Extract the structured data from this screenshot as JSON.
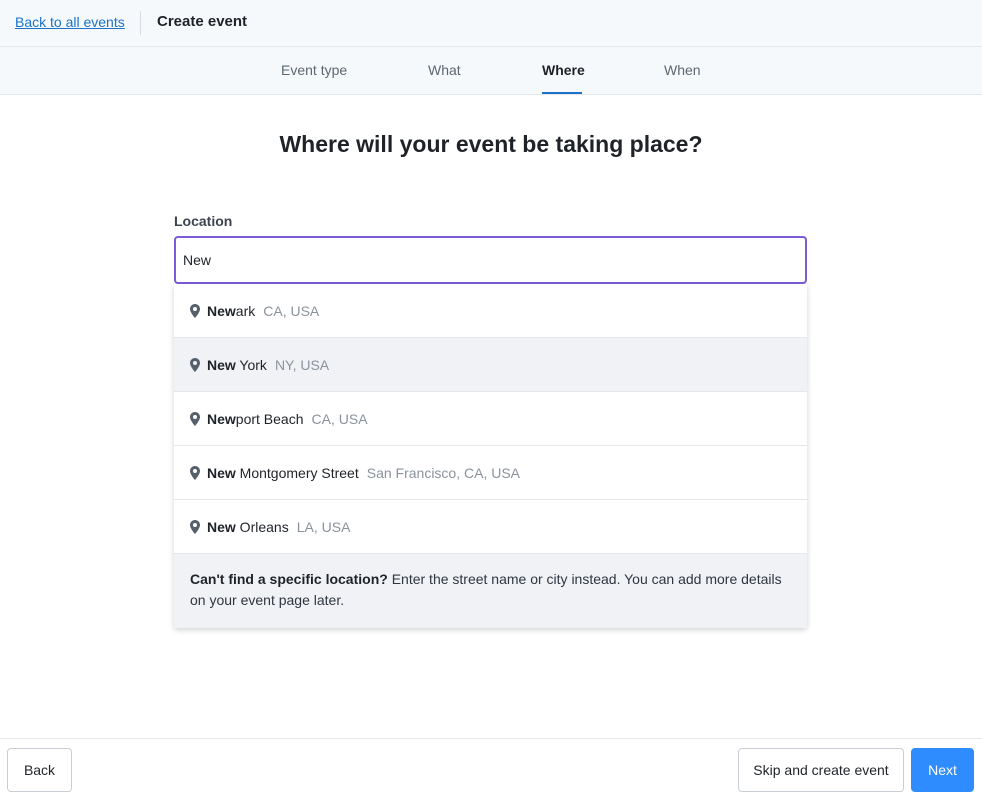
{
  "header": {
    "back_link": "Back to all events",
    "title": "Create event"
  },
  "steps": [
    {
      "label": "Event type",
      "active": false
    },
    {
      "label": "What",
      "active": false
    },
    {
      "label": "Where",
      "active": true
    },
    {
      "label": "When",
      "active": false
    }
  ],
  "main": {
    "heading": "Where will your event be taking place?",
    "location_label": "Location",
    "location_value": "New"
  },
  "suggestions": [
    {
      "match": "New",
      "rest": "ark",
      "region": "CA, USA",
      "icon": "map-pin-icon"
    },
    {
      "match": "New",
      "rest": " York",
      "region": "NY, USA",
      "icon": "map-pin-icon",
      "highlighted": true
    },
    {
      "match": "New",
      "rest": "port Beach",
      "region": "CA, USA",
      "icon": "map-pin-icon"
    },
    {
      "match": "New",
      "rest": " Montgomery Street",
      "region": "San Francisco, CA, USA",
      "icon": "map-pin-icon"
    },
    {
      "match": "New",
      "rest": " Orleans",
      "region": "LA, USA",
      "icon": "map-pin-icon"
    }
  ],
  "hint": {
    "bold": "Can't find a specific location?",
    "text": " Enter the street name or city instead. You can add more details on your event page later."
  },
  "footer": {
    "back_label": "Back",
    "skip_label": "Skip and create event",
    "next_label": "Next"
  },
  "colors": {
    "accent_blue": "#1a73c8",
    "next_button": "#2f8cff",
    "input_focus": "#7b5cd6"
  }
}
